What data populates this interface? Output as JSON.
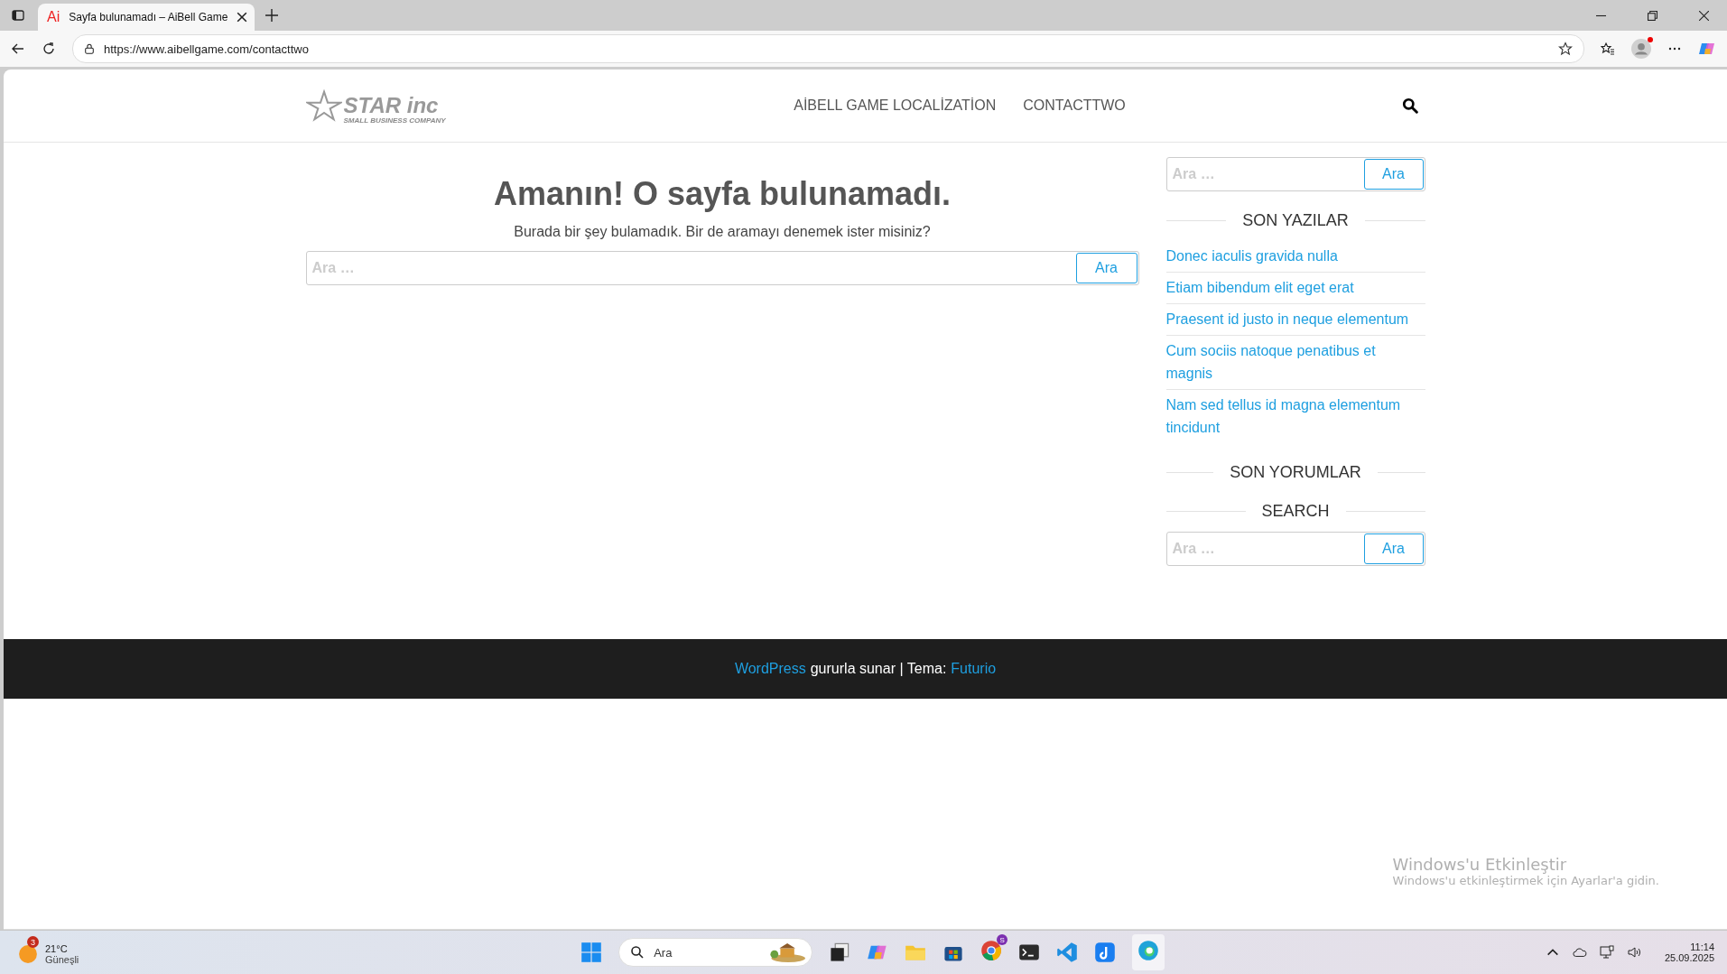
{
  "browser": {
    "tab": {
      "icon_text": "Ai",
      "title": "Sayfa bulunamadı – AiBell Game",
      "selected": true
    },
    "url": "https://www.aibellgame.com/contacttwo",
    "profile_notification": true
  },
  "site_header": {
    "logo": {
      "name": "STAR inc",
      "tagline": "SMALL BUSINESS COMPANY"
    },
    "nav": [
      {
        "label": "AİBELL GAME LOCALİZATİON"
      },
      {
        "label": "CONTACTTWO"
      }
    ]
  },
  "main": {
    "title": "Amanın! O sayfa bulunamadı.",
    "message": "Burada bir şey bulamadık. Bir de aramayı denemek ister misiniz?",
    "search": {
      "placeholder": "Ara …",
      "button": "Ara"
    }
  },
  "sidebar": {
    "top_search": {
      "placeholder": "Ara …",
      "button": "Ara"
    },
    "widgets": [
      {
        "kind": "posts",
        "title": "SON YAZILAR",
        "items": [
          "Donec iaculis gravida nulla",
          "Etiam bibendum elit eget erat",
          "Praesent id justo in neque elementum",
          "Cum sociis natoque penatibus et magnis",
          "Nam sed tellus id magna elementum tincidunt"
        ]
      },
      {
        "kind": "comments",
        "title": "SON YORUMLAR"
      },
      {
        "kind": "search",
        "title": "SEARCH",
        "placeholder": "Ara …",
        "button": "Ara"
      }
    ]
  },
  "footer": {
    "link_1": "WordPress",
    "text": "gururla sunar | Tema:",
    "link_2": "Futurio"
  },
  "activation": {
    "title": "Windows'u Etkinleştir",
    "message": "Windows'u etkinleştirmek için Ayarlar'a gidin."
  },
  "taskbar": {
    "weather": {
      "badge": "3",
      "temperature": "21°C",
      "condition": "Güneşli"
    },
    "search_placeholder": "Ara",
    "chrome_badge": "S",
    "time": "11:14",
    "date": "25.09.2025"
  }
}
